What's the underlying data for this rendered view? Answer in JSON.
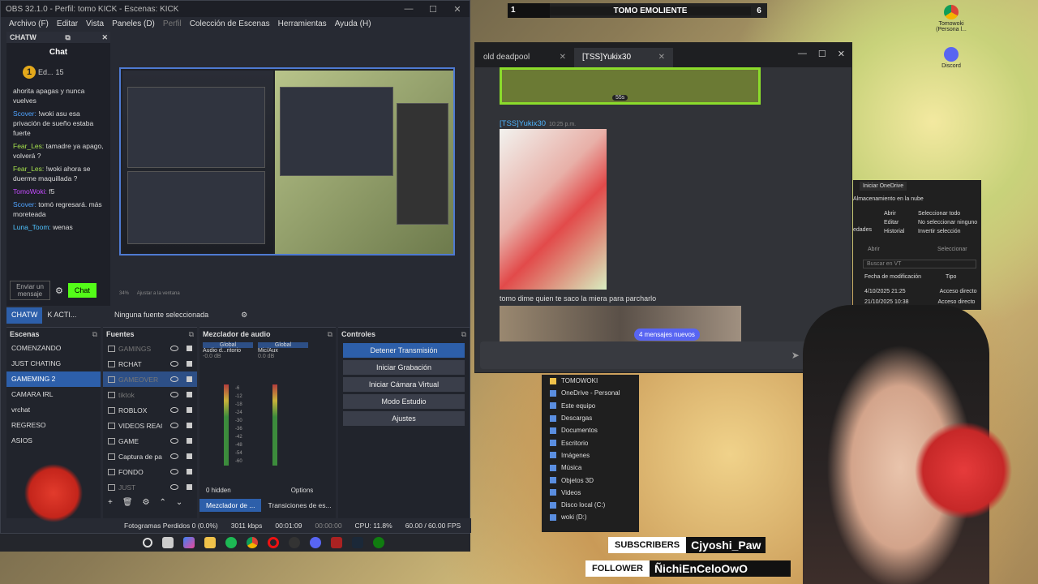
{
  "hud": {
    "left": "1",
    "center": "TOMO EMOLIENTE",
    "right": "6"
  },
  "desktop": {
    "icon1": "Tomowoki (Persona l...",
    "icon2": "Discord"
  },
  "obs": {
    "title": "OBS 32.1.0 - Perfil: tomo KICK - Escenas: KICK",
    "menu": [
      "Archivo (F)",
      "Editar",
      "Vista",
      "Paneles (D)",
      "Perfil",
      "Colección de Escenas",
      "Herramientas",
      "Ayuda (H)"
    ],
    "chat_dock": {
      "header": "CHATW",
      "title": "Chat",
      "top_user": "Ed...",
      "top_count": "15",
      "messages": [
        {
          "user": "",
          "text": "ahorita apagas y nunca vuelves"
        },
        {
          "user": "Scover:",
          "text": "!woki asu esa privación de sueño estaba fuerte"
        },
        {
          "user": "Fear_Les:",
          "text": "tamadre ya apago, volverá ?"
        },
        {
          "user": "Fear_Les:",
          "text": "!woki ahora se duerme maquillada ?"
        },
        {
          "user": "TomoWoki:",
          "text": "f5"
        },
        {
          "user": "Scover:",
          "text": "tomó regresará. más moreteada"
        },
        {
          "user": "Luna_Toom:",
          "text": "wenas"
        }
      ],
      "input_placeholder": "Enviar un mensaje",
      "send": "Chat"
    },
    "dock_tabs": [
      "CHATW",
      "K ACTI..."
    ],
    "preview_zoom": "34%",
    "preview_fit": "Ajustar a la ventana",
    "no_source": "Ninguna fuente seleccionada",
    "scenes": {
      "title": "Escenas",
      "items": [
        "COMENZANDO",
        "JUST CHATING",
        "GAMEMING 2",
        "CAMARA IRL",
        "vrchat",
        "REGRESO",
        "ASIOS"
      ],
      "selected": "GAMEMING 2"
    },
    "sources": {
      "title": "Fuentes",
      "items": [
        "GAMINGS",
        "RCHAT",
        "GAMEOVER",
        "tiktok",
        "ROBLOX",
        "VIDEOS REACC",
        "GAME",
        "Captura de pa",
        "FONDO",
        "JUST"
      ]
    },
    "mixer": {
      "title": "Mezclador de audio",
      "ch1_tag": "Global",
      "ch1_name": "Audio d...ritorio",
      "ch1_db": "-0.0 dB",
      "ch2_tag": "Global",
      "ch2_name": "Mic/Aux",
      "ch2_db": "0.0 dB",
      "scale": [
        "-6",
        "-12",
        "-18",
        "-24",
        "-30",
        "-36",
        "-42",
        "-48",
        "-54",
        "-60"
      ],
      "hidden": "0 hidden",
      "options": "Options"
    },
    "controls": {
      "title": "Controles",
      "buttons": [
        "Detener Transmisión",
        "Iniciar Grabación",
        "Iniciar Cámara Virtual",
        "Modo Estudio",
        "Ajustes"
      ]
    },
    "bottom_tabs": [
      "Mezclador de ...",
      "Transiciones de es..."
    ],
    "status": {
      "frames": "Fotogramas Perdidos 0 (0.0%)",
      "kbps": "3011 kbps",
      "live": "00:01:09",
      "rec": "00:00:00",
      "cpu": "CPU: 11.8%",
      "fps": "60.00 / 60.00 FPS"
    }
  },
  "discord": {
    "tabs": [
      "old deadpool",
      "[TSS]Yukix30"
    ],
    "gif_time": "55s",
    "user": "[TSS]Yukix30",
    "time": "10:25 p.m.",
    "message": "tomo dime quien te saco la miera para parcharlo",
    "new_messages": "4 mensajes nuevos"
  },
  "explorer": {
    "items": [
      "TOMOWOKI",
      "OneDrive - Personal",
      "Este equipo",
      "Descargas",
      "Documentos",
      "Escritorio",
      "Imágenes",
      "Música",
      "Objetos 3D",
      "Videos",
      "Disco local (C:)",
      "woki (D:)"
    ]
  },
  "onedrive": {
    "start": "Iniciar OneDrive",
    "storage": "Almacenamiento en la nube",
    "abrir": "Abrir",
    "editar": "Editar",
    "historial": "Historial",
    "abrir_group": "Abrir",
    "sel_all": "Seleccionar todo",
    "sel_none": "No seleccionar ninguno",
    "sel_inv": "Invertir selección",
    "sel_group": "Seleccionar",
    "edades": "edades",
    "search": "Buscar en VT",
    "col_date": "Fecha de modificación",
    "col_type": "Tipo",
    "rows": [
      {
        "date": "4/10/2025 21:25",
        "type": "Acceso directo"
      },
      {
        "date": "21/10/2025 10:38",
        "type": "Acceso directo"
      }
    ]
  },
  "overlay": {
    "subs_label": "SUBSCRIBERS",
    "subs_value": "Cjyoshi_Paw",
    "follow_label": "FOLLOWER",
    "follow_value": "ÑichiEnCeloOwO"
  },
  "colors": {
    "obs_accent": "#2d5faa",
    "kick_green": "#53fc18",
    "discord_blurple": "#5865f2"
  }
}
